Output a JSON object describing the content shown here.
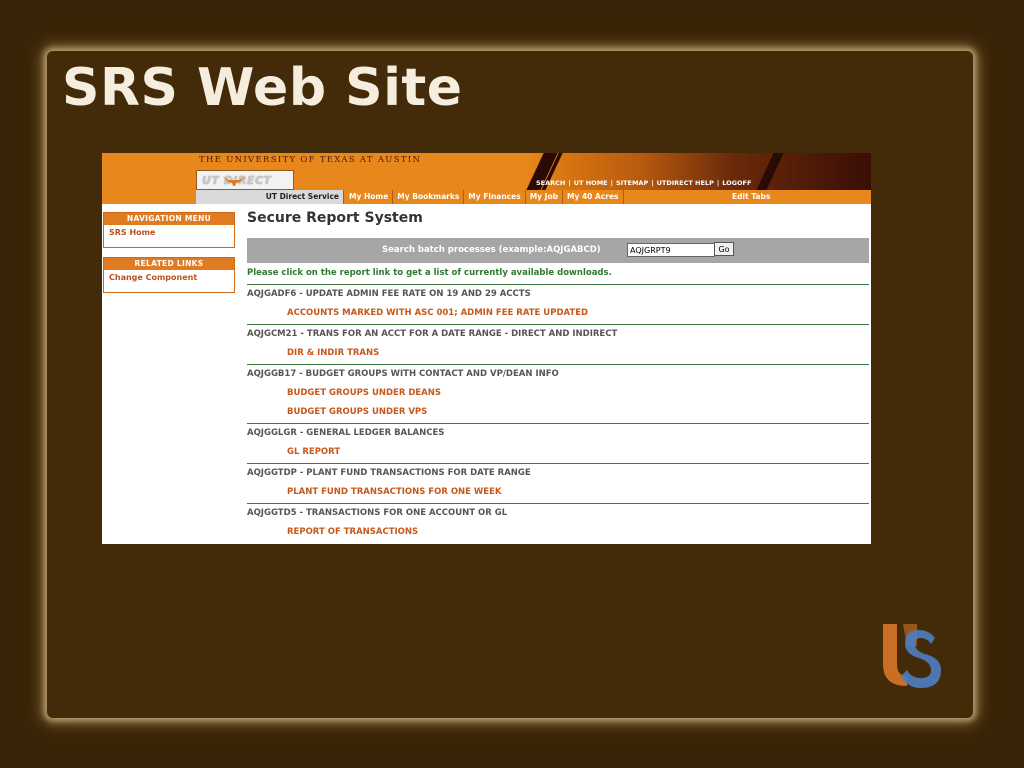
{
  "slide": {
    "title": "SRS Web Site"
  },
  "header": {
    "university": "THE UNIVERSITY OF TEXAS AT AUSTIN",
    "logo_text": "UT DIRECT",
    "links": [
      "SEARCH",
      "UT HOME",
      "SITEMAP",
      "UTDIRECT HELP",
      "LOGOFF"
    ]
  },
  "tabs": {
    "active": "UT Direct Service",
    "items": [
      "My Home",
      "My Bookmarks",
      "My Finances",
      "My Job",
      "My 40 Acres"
    ],
    "edit": "Edit Tabs"
  },
  "sidebar": {
    "nav_title": "NAVIGATION MENU",
    "nav_items": [
      "SRS Home"
    ],
    "related_title": "RELATED LINKS",
    "related_items": [
      "Change Component"
    ]
  },
  "main": {
    "title": "Secure Report System",
    "search_label": "Search batch processes (example:AQJGABCD)",
    "search_value": "AQJGRPT9",
    "go_label": "Go",
    "instruction": "Please click on the report link to get a list of currently available downloads.",
    "reports": [
      {
        "title": "AQJGADF6 - UPDATE ADMIN FEE RATE ON 19 AND 29 ACCTS",
        "links": [
          "ACCOUNTS MARKED WITH ASC 001; ADMIN FEE RATE UPDATED"
        ]
      },
      {
        "title": "AQJGCM21 - TRANS FOR AN ACCT FOR A DATE RANGE - DIRECT AND INDIRECT",
        "links": [
          "DIR & INDIR TRANS"
        ]
      },
      {
        "title": "AQJGGB17 - BUDGET GROUPS WITH CONTACT AND VP/DEAN INFO",
        "links": [
          "BUDGET GROUPS UNDER DEANS",
          "BUDGET GROUPS UNDER VPS"
        ]
      },
      {
        "title": "AQJGGLGR - GENERAL LEDGER BALANCES",
        "links": [
          "GL REPORT"
        ]
      },
      {
        "title": "AQJGGTDP - PLANT FUND TRANSACTIONS FOR DATE RANGE",
        "links": [
          "PLANT FUND TRANSACTIONS FOR ONE WEEK"
        ]
      },
      {
        "title": "AQJGGTD5 - TRANSACTIONS FOR ONE ACCOUNT OR GL",
        "links": [
          "REPORT OF TRANSACTIONS"
        ]
      }
    ]
  },
  "colors": {
    "background": "#3a2407",
    "frame": "#432a09",
    "ut_orange": "#e8871b",
    "link": "#c7581a",
    "rule": "#3e7a3e"
  },
  "logo": {
    "icon": "us-monogram-icon"
  }
}
